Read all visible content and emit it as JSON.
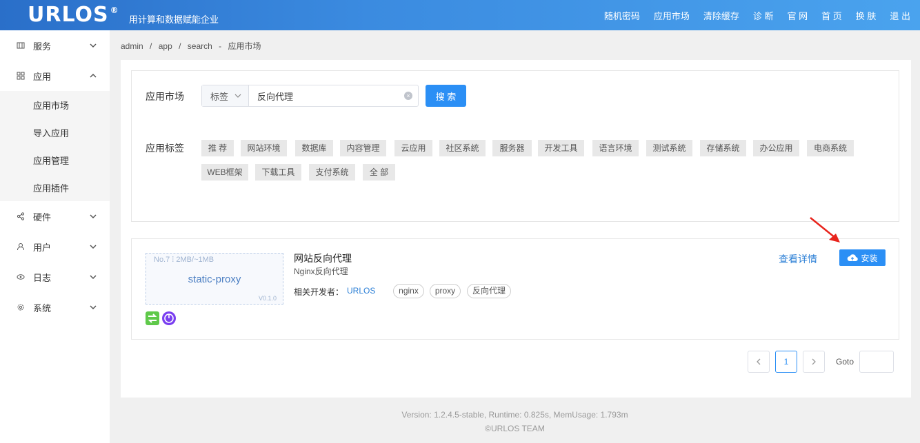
{
  "header": {
    "logo": "URLOS",
    "logo_mark": "®",
    "slogan": "用计算和数据赋能企业",
    "nav": [
      "随机密码",
      "应用市场",
      "清除缓存",
      "诊 断",
      "官 网",
      "首 页",
      "换 肤",
      "退 出"
    ]
  },
  "sidebar": {
    "items": [
      {
        "label": "服务",
        "icon": "service-icon"
      },
      {
        "label": "应用",
        "icon": "grid-icon"
      },
      {
        "label": "硬件",
        "icon": "share-icon"
      },
      {
        "label": "用户",
        "icon": "user-icon"
      },
      {
        "label": "日志",
        "icon": "eye-icon"
      },
      {
        "label": "系统",
        "icon": "gear-icon"
      }
    ],
    "app_submenu": [
      "应用市场",
      "导入应用",
      "应用管理",
      "应用插件"
    ]
  },
  "breadcrumb": [
    "admin",
    "/",
    "app",
    "/",
    "search",
    "-",
    "应用市场"
  ],
  "search": {
    "label": "应用市场",
    "type_select": "标签",
    "value": "反向代理",
    "button": "搜 索"
  },
  "tags": {
    "label": "应用标签",
    "items": [
      "推 荐",
      "网站环境",
      "数据库",
      "内容管理",
      "云应用",
      "社区系统",
      "服务器",
      "开发工具",
      "语言环境",
      "测试系统",
      "存储系统",
      "办公应用",
      "电商系统",
      "WEB框架",
      "下载工具",
      "支付系统",
      "全 部"
    ]
  },
  "app": {
    "thumb_meta": "No.7 ⁞ 2MB/~1MB",
    "thumb_name": "static-proxy",
    "thumb_version": "V0.1.0",
    "title": "网站反向代理",
    "description": "Nginx反向代理",
    "dev_label": "相关开发者：",
    "developer": "URLOS",
    "pills": [
      "nginx",
      "proxy",
      "反向代理"
    ],
    "detail_link": "查看详情",
    "install_button": "安装",
    "icon_colors": {
      "switch": "#5fc94a",
      "power": "#7a3ff0"
    }
  },
  "pagination": {
    "current": "1",
    "goto_label": "Goto"
  },
  "footer": {
    "line1": "Version: 1.2.4.5-stable,   Runtime: 0.825s,   MemUsage: 1.793m",
    "line2": "©URLOS TEAM"
  }
}
